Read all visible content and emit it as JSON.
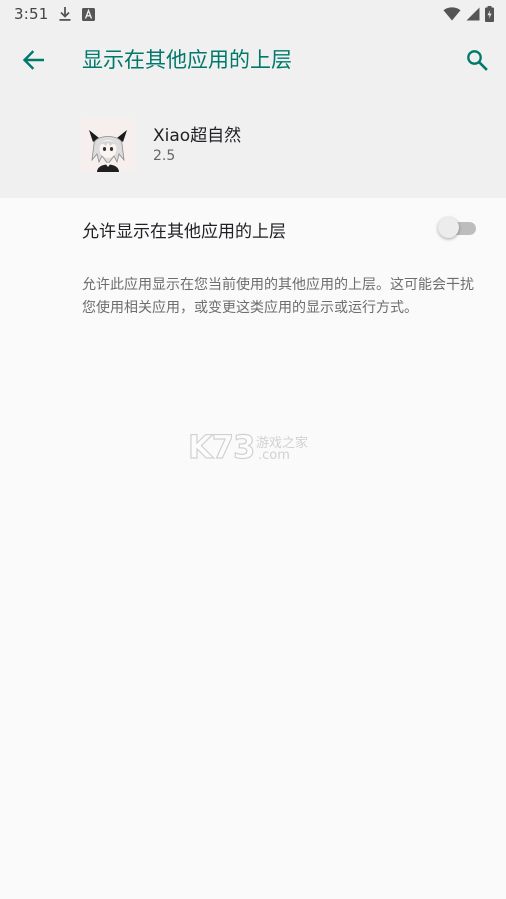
{
  "status_bar": {
    "time": "3:51",
    "icons": [
      "download-icon",
      "keyboard-a-icon",
      "wifi-icon",
      "signal-icon",
      "battery-icon"
    ]
  },
  "app_bar": {
    "title": "显示在其他应用的上层",
    "back_icon": "arrow-back-icon",
    "search_icon": "search-icon"
  },
  "app_info": {
    "name": "Xiao超自然",
    "version": "2.5"
  },
  "permission": {
    "toggle_label": "允许显示在其他应用的上层",
    "enabled": false,
    "description": "允许此应用显示在您当前使用的其他应用的上层。这可能会干扰您使用相关应用，或变更这类应用的显示或运行方式。"
  },
  "watermark": {
    "logo_text": "K73",
    "site_name": "游戏之家",
    "domain": ".com"
  },
  "colors": {
    "accent": "#00796b",
    "header_bg": "#f0f0f0",
    "page_bg": "#fafafa"
  }
}
